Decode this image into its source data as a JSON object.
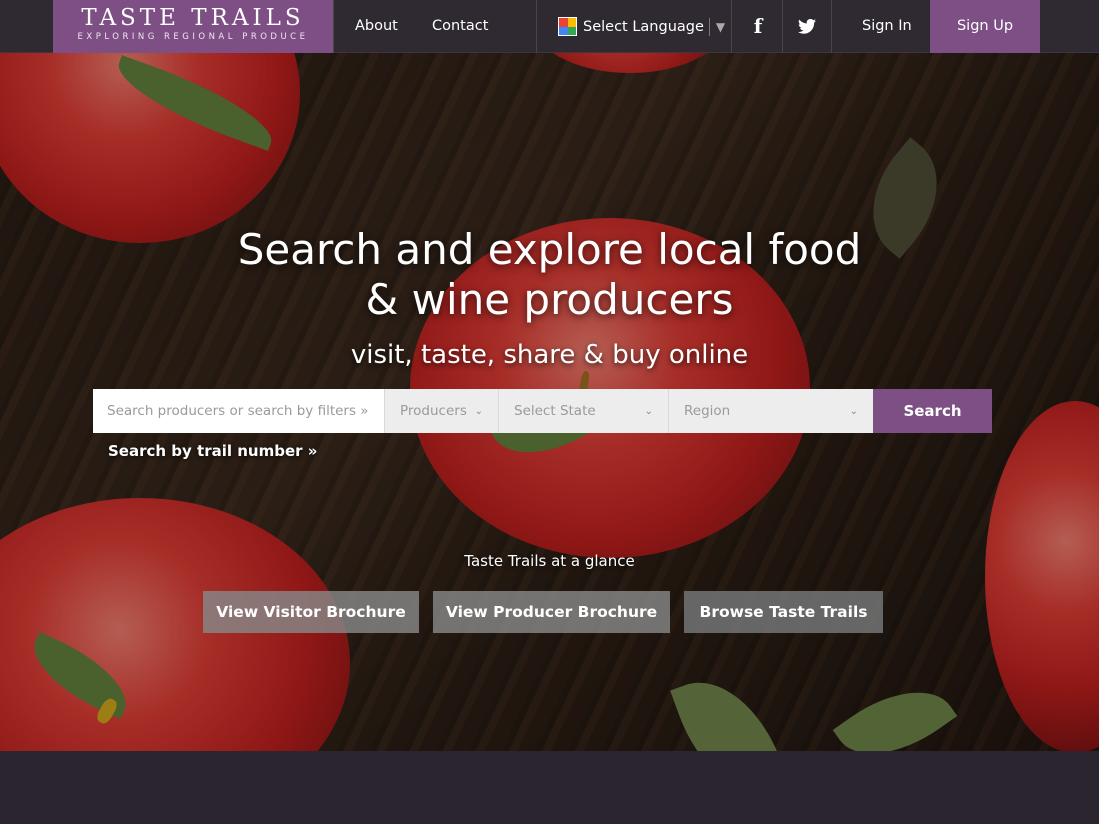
{
  "header": {
    "logo_title": "Taste Trails",
    "logo_subtitle": "Exploring Regional Produce",
    "nav": {
      "about": "About",
      "contact": "Contact"
    },
    "language_label": "Select Language",
    "facebook_glyph": "f",
    "signin": "Sign In",
    "signup": "Sign Up"
  },
  "hero": {
    "headline_line1": "Search and explore local food",
    "headline_line2": "& wine producers",
    "tagline": "visit, taste, share & buy online"
  },
  "search": {
    "placeholder": "Search producers or search by filters »",
    "producers": "Producers",
    "state": "Select State",
    "region": "Region",
    "button": "Search",
    "trail_link": "Search by trail number »"
  },
  "glance": {
    "title": "Taste Trails at a glance",
    "buttons": [
      "View Visitor Brochure",
      "View Producer Brochure",
      "Browse Taste Trails"
    ]
  },
  "icons": [
    "google-translate-icon",
    "caret-down-icon",
    "facebook-icon",
    "twitter-icon",
    "chevron-down-icon"
  ],
  "colors": {
    "brand": "#7d4f84",
    "topbar": "#2f2a31",
    "footer": "#2b2530"
  }
}
